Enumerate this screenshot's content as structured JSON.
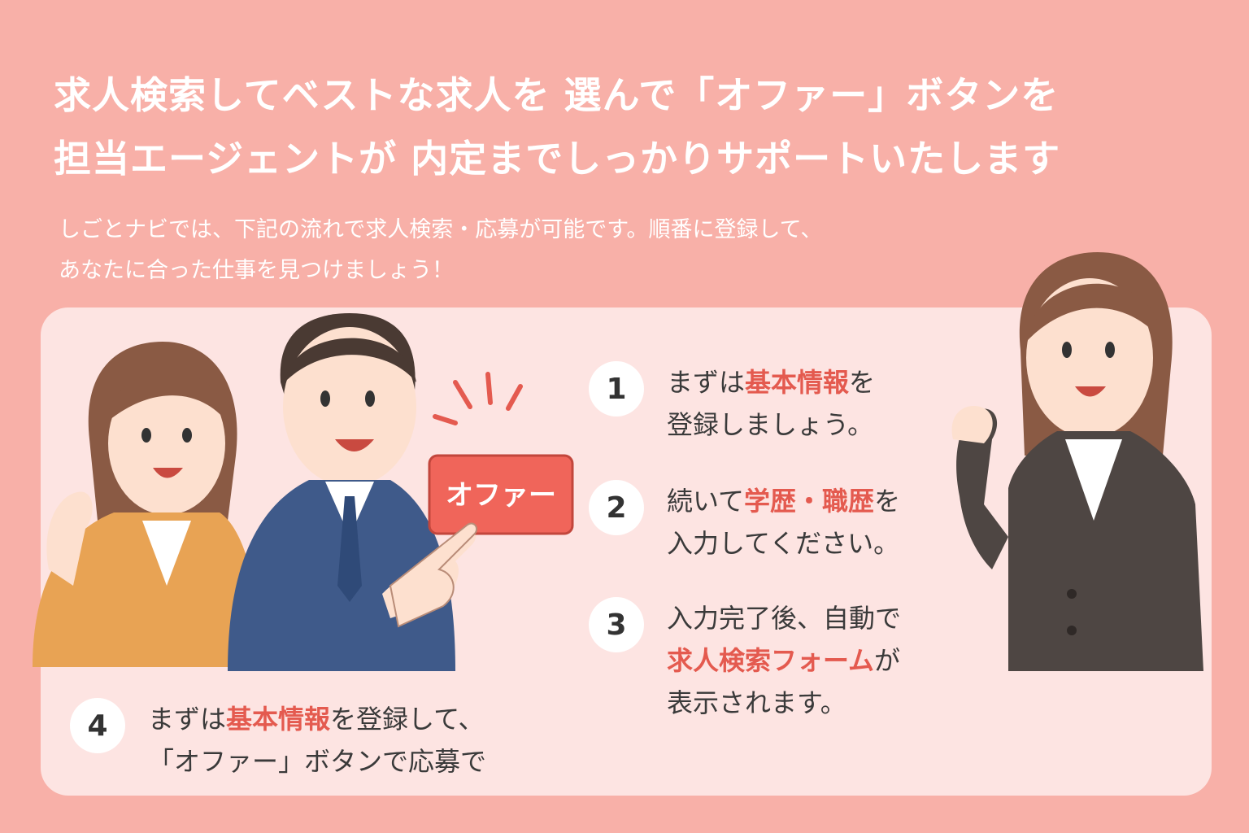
{
  "headline": {
    "line1": "求人検索してベストな求人を 選んで「オファー」ボタンを",
    "line2": "担当エージェントが 内定までしっかりサポートいたします"
  },
  "intro": {
    "line1": "しごとナビでは、下記の流れで求人検索・応募が可能です。順番に登録して、",
    "line2": "あなたに合った仕事を見つけましょう！"
  },
  "offer_button": {
    "label": "オファー"
  },
  "steps": [
    {
      "number": "1",
      "line1_pre": "まずは",
      "line1_hl": "基本情報",
      "line1_post": "を",
      "line2": "登録しましょう。"
    },
    {
      "number": "2",
      "line1_pre": "続いて",
      "line1_hl": "学歴・職歴",
      "line1_post": "を",
      "line2": "入力してください。"
    },
    {
      "number": "3",
      "line1": "入力完了後、自動で",
      "line2_hl": "求人検索フォーム",
      "line2_post": "が",
      "line3": "表示されます。"
    },
    {
      "number": "4",
      "line1_pre": "まずは",
      "line1_hl": "基本情報",
      "line1_post": "を登録して、",
      "line2": "「オファー」ボタンで応募で"
    }
  ],
  "colors": {
    "background": "#f8b0a8",
    "panel": "#fde4e2",
    "highlight": "#e45a4f",
    "offer_button": "#f0655a"
  },
  "icons": [
    "woman-character-icon",
    "man-character-icon",
    "agent-character-icon",
    "pointing-hand-icon",
    "sparkle-icon"
  ]
}
